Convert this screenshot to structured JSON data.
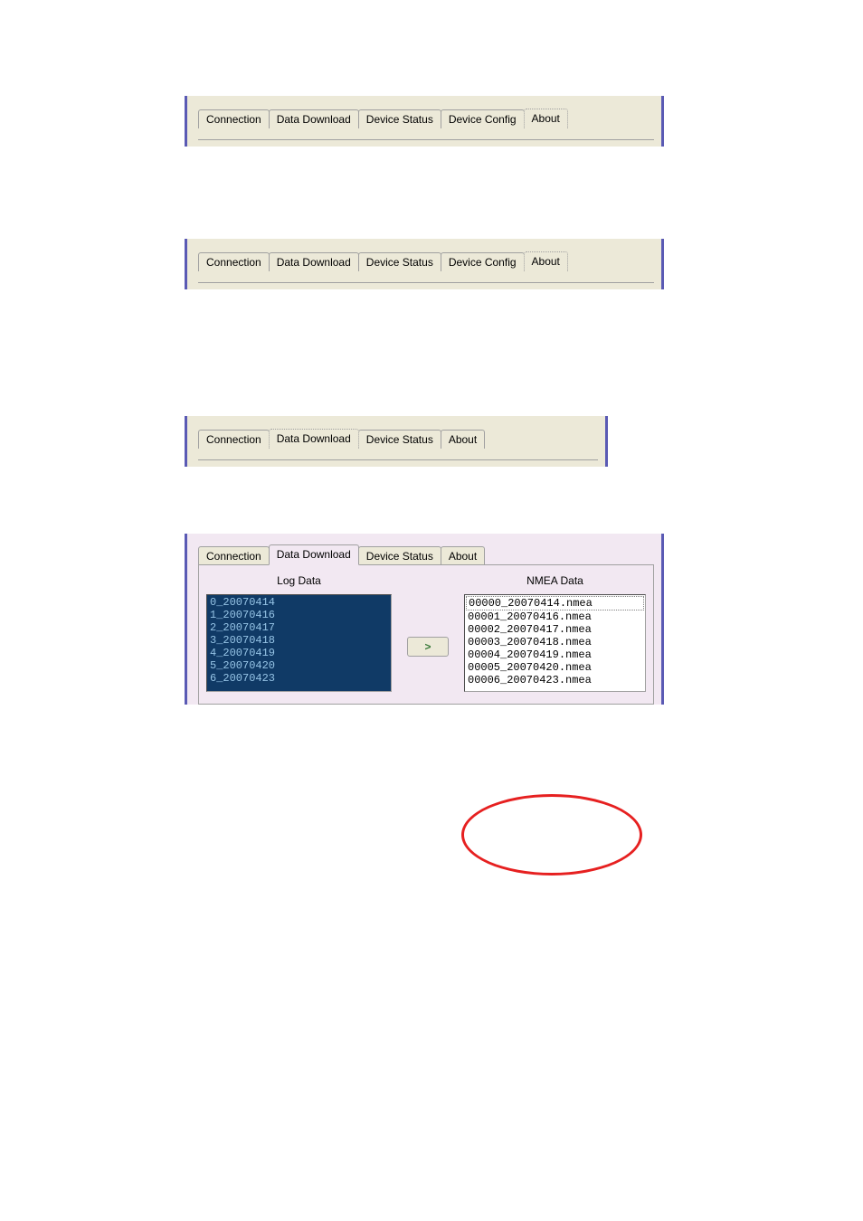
{
  "panel_top_a": {
    "tabs": [
      "Connection",
      "Data Download",
      "Device Status",
      "Device Config",
      "About"
    ],
    "active_index": 4
  },
  "panel_top_b": {
    "tabs": [
      "Connection",
      "Data Download",
      "Device Status",
      "Device Config",
      "About"
    ],
    "active_index": 4
  },
  "panel_mid": {
    "tabs": [
      "Connection",
      "Data Download",
      "Device Status",
      "About"
    ],
    "active_index": 1
  },
  "panel_download": {
    "tabs": [
      "Connection",
      "Data Download",
      "Device Status",
      "About"
    ],
    "active_index": 1,
    "left_header": "Log Data",
    "right_header": "NMEA Data",
    "arrow_label": ">",
    "log_items": [
      "0_20070414",
      "1_20070416",
      "2_20070417",
      "3_20070418",
      "4_20070419",
      "5_20070420",
      "6_20070423"
    ],
    "nmea_items": [
      "00000_20070414.nmea",
      "00001_20070416.nmea",
      "00002_20070417.nmea",
      "00003_20070418.nmea",
      "00004_20070419.nmea",
      "00005_20070420.nmea",
      "00006_20070423.nmea"
    ],
    "nmea_selected_index": 0
  }
}
